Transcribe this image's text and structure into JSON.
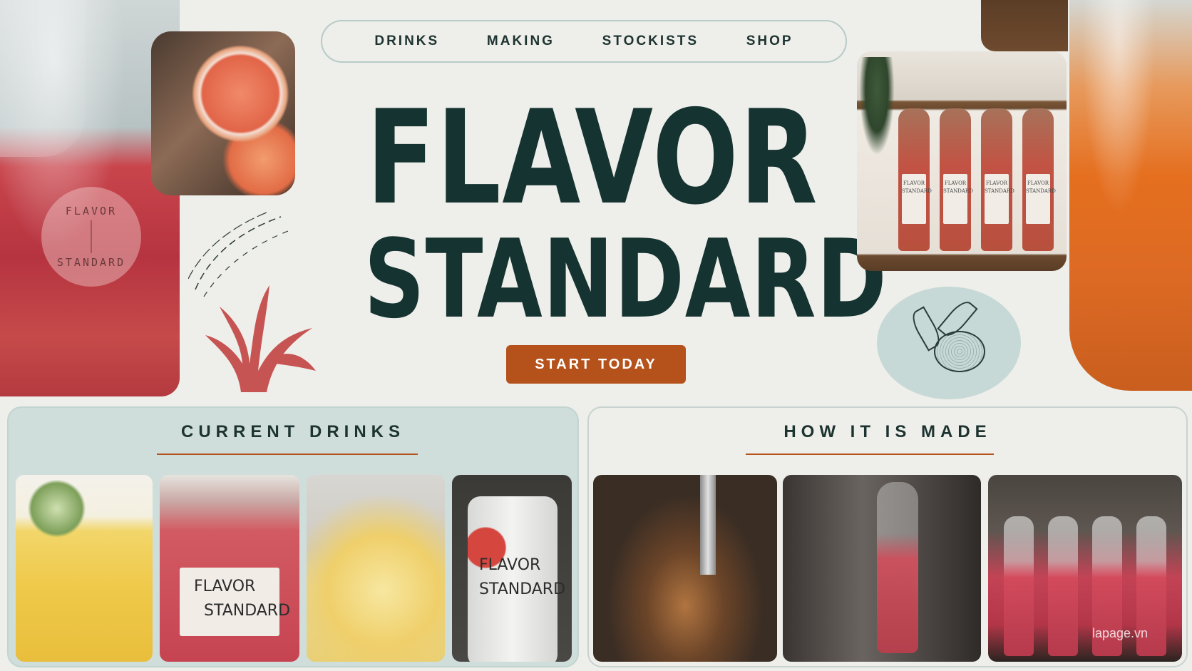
{
  "nav": {
    "items": [
      {
        "label": "DRINKS"
      },
      {
        "label": "MAKING"
      },
      {
        "label": "STOCKISTS"
      },
      {
        "label": "SHOP"
      }
    ]
  },
  "hero": {
    "title_line1": "FLAVOR",
    "title_line2": "STANDARD",
    "cta_label": "START TODAY"
  },
  "sections": {
    "current_drinks": {
      "title": "CURRENT DRINKS",
      "tiles": [
        {
          "icon": "cucumber-lemonade-photo"
        },
        {
          "icon": "red-bottle-photo",
          "label_line1": "FLAVOR",
          "label_line2": "STANDARD"
        },
        {
          "icon": "thyme-drink-photo"
        },
        {
          "icon": "can-photo",
          "label_line1": "FLAVOR",
          "label_line2": "STANDARD"
        }
      ]
    },
    "how_it_is_made": {
      "title": "HOW IT IS MADE",
      "tiles": [
        {
          "icon": "brewing-kettle-photo"
        },
        {
          "icon": "filling-bottle-photo"
        },
        {
          "icon": "bottling-line-photo"
        }
      ]
    }
  },
  "decor": {
    "stamp_text_top": "FLAVOR",
    "stamp_text_bottom": "STANDARD",
    "shelf_bottle_label": "FLAVOR STANDARD"
  },
  "watermark": "lapage.vn",
  "colors": {
    "accent": "#b5521c",
    "ink": "#1d3330",
    "panel": "#cfdedb",
    "background": "#eeeeea"
  }
}
